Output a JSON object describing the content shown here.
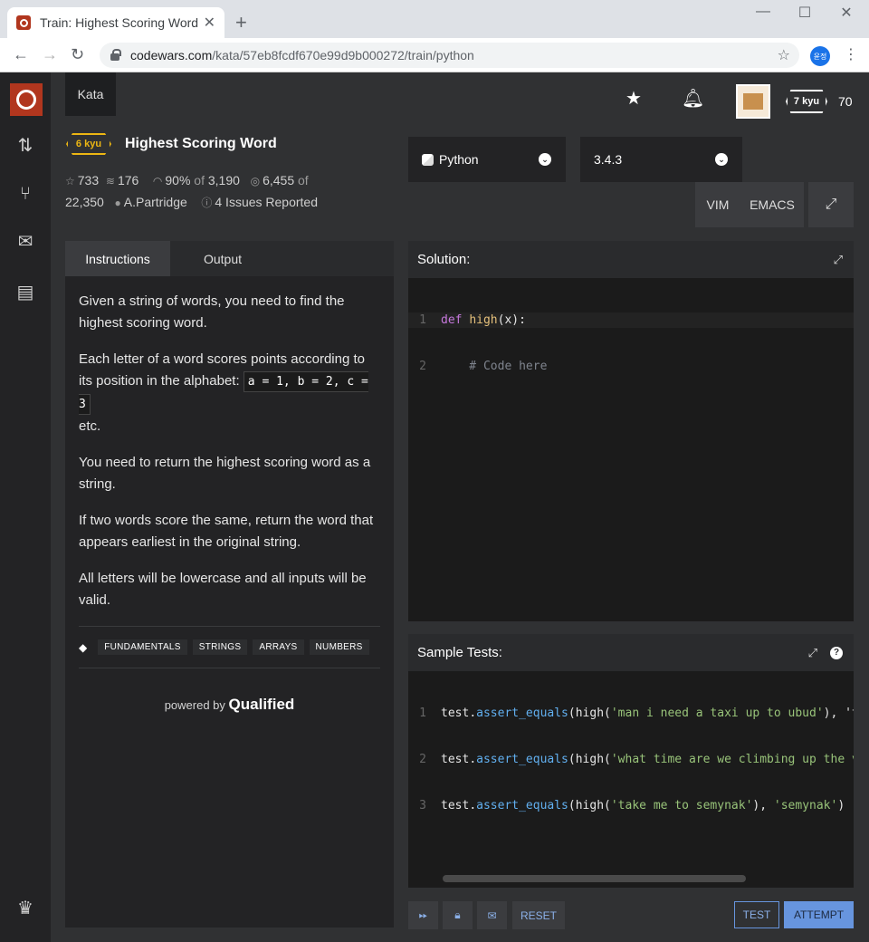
{
  "browser": {
    "tab_title": "Train: Highest Scoring Word",
    "url_host": "codewars.com",
    "url_path": "/kata/57eb8fcdf670e99d9b000272/train/python",
    "profile_label": "윤정"
  },
  "header": {
    "kata_tab": "Kata",
    "user_rank": "7 kyu",
    "honor": "70"
  },
  "kata": {
    "rank": "6 kyu",
    "title": "Highest Scoring Word",
    "stars": "733",
    "collections": "176",
    "satisfaction": "90%",
    "satisfaction_of": "of",
    "satisfaction_total": "3,190",
    "completed": "6,455",
    "completed_of": "of",
    "attempts": "22,350",
    "author": "A.Partridge",
    "issues": "4 Issues Reported"
  },
  "language": {
    "name": "Python",
    "version": "3.4.3",
    "modes": [
      "VIM",
      "EMACS"
    ]
  },
  "instructions": {
    "tabs": [
      "Instructions",
      "Output"
    ],
    "p1": "Given a string of words, you need to find the highest scoring word.",
    "p2a": "Each letter of a word scores points according to its position in the alphabet:",
    "p2_code": "a = 1, b = 2, c = 3",
    "p2b": "etc.",
    "p3": "You need to return the highest scoring word as a string.",
    "p4": "If two words score the same, return the word that appears earliest in the original string.",
    "p5": "All letters will be lowercase and all inputs will be valid.",
    "tags": [
      "FUNDAMENTALS",
      "STRINGS",
      "ARRAYS",
      "NUMBERS"
    ],
    "powered_by": "powered by",
    "powered_brand": "Qualified"
  },
  "solution": {
    "title": "Solution:",
    "lines": [
      {
        "n": "1",
        "kw": "def",
        "fn": "high",
        "rest": "(x):"
      },
      {
        "n": "2",
        "comment": "    # Code here"
      }
    ]
  },
  "tests": {
    "title": "Sample Tests:",
    "lines": [
      {
        "n": "1",
        "obj": "test",
        "meth": "assert_equals",
        "pre": "(high(",
        "str": "'man i need a taxi up to ubud'",
        "post": "), 't"
      },
      {
        "n": "2",
        "obj": "test",
        "meth": "assert_equals",
        "pre": "(high(",
        "str": "'what time are we climbing up the v",
        "post": ""
      },
      {
        "n": "3",
        "obj": "test",
        "meth": "assert_equals",
        "pre": "(high(",
        "str": "'take me to semynak'",
        "post": "), ",
        "str2": "'semynak'",
        "end": ")"
      }
    ]
  },
  "actions": {
    "reset": "RESET",
    "test": "TEST",
    "attempt": "ATTEMPT"
  }
}
